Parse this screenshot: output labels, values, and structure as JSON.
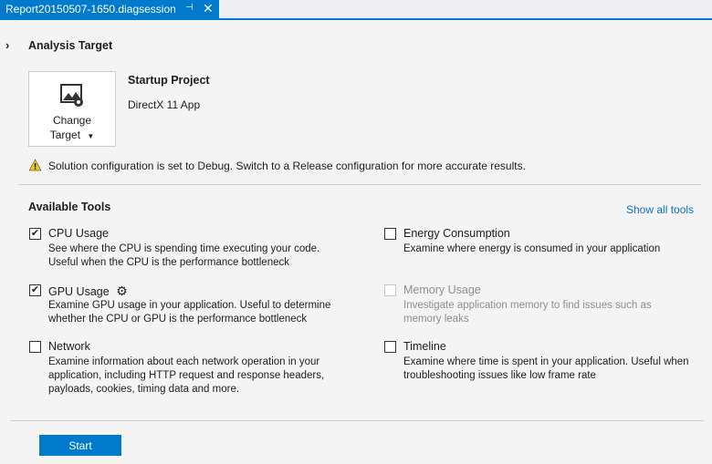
{
  "tab": {
    "title": "Report20150507-1650.diagsession",
    "pin": "⊣",
    "close": "✕"
  },
  "analysis": {
    "header": "Analysis Target",
    "change_target_line1": "Change",
    "change_target_line2": "Target",
    "startup_label": "Startup Project",
    "startup_value": "DirectX 11 App",
    "warning": "Solution configuration is set to Debug. Switch to a Release configuration for more accurate results."
  },
  "tools": {
    "header": "Available Tools",
    "show_all": "Show all tools",
    "items": [
      {
        "label": "CPU Usage",
        "checked": true,
        "desc": "See where the CPU is spending time executing your code.\nUseful when the CPU is the performance bottleneck"
      },
      {
        "label": "GPU Usage",
        "checked": true,
        "desc": "Examine GPU usage in your application. Useful to determine\nwhether the CPU or GPU is the performance bottleneck"
      },
      {
        "label": "Network",
        "checked": false,
        "desc": "Examine information about each network operation in your\napplication, including HTTP request and response headers,\npayloads, cookies, timing data and more."
      },
      {
        "label": "Energy Consumption",
        "checked": false,
        "desc": "Examine where energy is consumed in your application"
      },
      {
        "label": "Memory Usage",
        "checked": false,
        "disabled": true,
        "desc": "Investigate application memory to find issues such as\nmemory leaks"
      },
      {
        "label": "Timeline",
        "checked": false,
        "desc": "Examine where time is spent in your application. Useful when\ntroubleshooting issues like low frame rate"
      }
    ]
  },
  "start_label": "Start"
}
